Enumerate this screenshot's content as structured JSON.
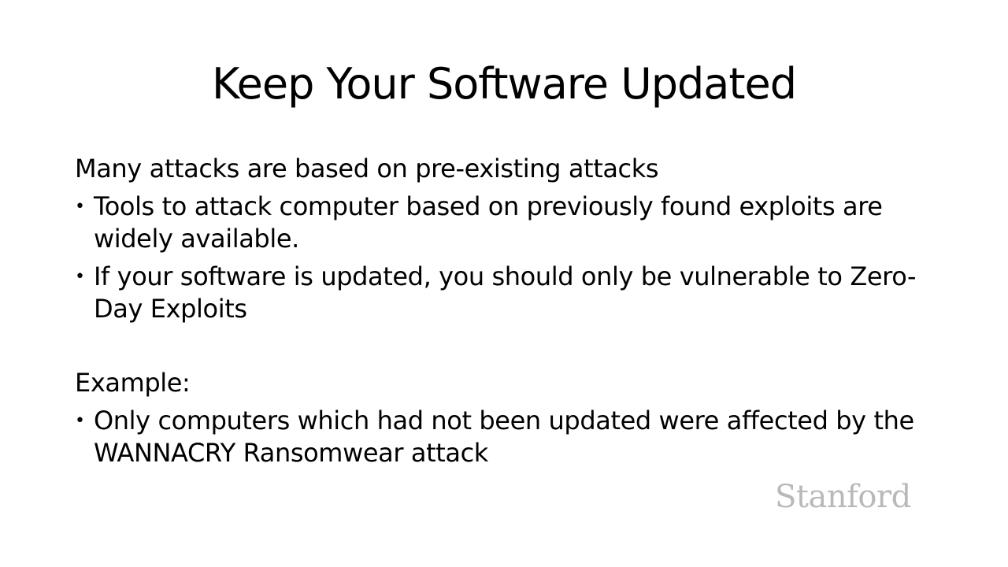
{
  "slide": {
    "title": "Keep Your Software Updated",
    "sections": [
      {
        "heading": "Many attacks are based on pre-existing attacks",
        "bullets": [
          "Tools to attack computer based on previously found exploits are widely available.",
          "If your software is updated, you should only be vulnerable to Zero-Day Exploits"
        ]
      },
      {
        "heading": "Example:",
        "bullets": [
          "Only computers which had not been updated were affected by the WANNACRY Ransomwear attack"
        ]
      }
    ],
    "bullet_glyph": "•",
    "logo_text": "Stanford",
    "colors": {
      "background": "#ffffff",
      "text": "#000000",
      "logo": "#b9b9b9"
    }
  }
}
